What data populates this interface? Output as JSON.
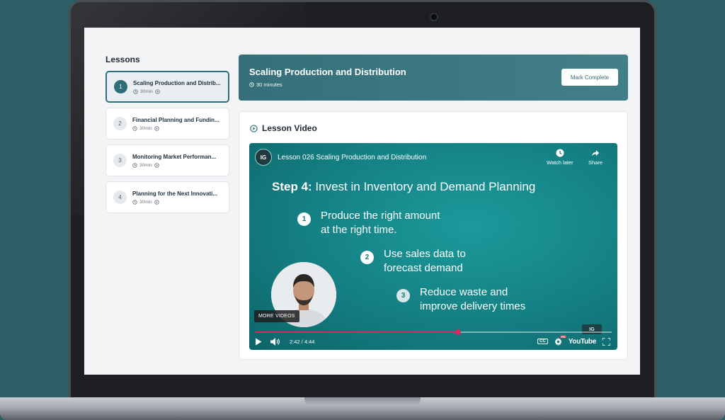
{
  "sidebar": {
    "title": "Lessons",
    "items": [
      {
        "number": "1",
        "title": "Scaling Production and Distrib...",
        "duration": "30min",
        "active": true
      },
      {
        "number": "2",
        "title": "Financial Planning and Fundin...",
        "duration": "30min",
        "active": false
      },
      {
        "number": "3",
        "title": "Monitoring Market Performan...",
        "duration": "30min",
        "active": false
      },
      {
        "number": "4",
        "title": "Planning for the Next Innovati...",
        "duration": "30min",
        "active": false
      }
    ]
  },
  "header": {
    "title": "Scaling Production and Distribution",
    "duration": "30 minutes",
    "mark_complete_label": "Mark Complete"
  },
  "video_section": {
    "title": "Lesson Video"
  },
  "player": {
    "channel_logo_text": "IG",
    "video_title": "Lesson 026 Scaling Production and Distribution",
    "watch_later_label": "Watch later",
    "share_label": "Share",
    "step_label": "Step 4:",
    "step_heading": "Invest in Inventory and Demand Planning",
    "points": [
      {
        "number": "1",
        "line1": "Produce the right amount",
        "line2": "at the right time."
      },
      {
        "number": "2",
        "line1": "Use sales data to",
        "line2": "forecast demand"
      },
      {
        "number": "3",
        "line1": "Reduce waste and",
        "line2": "improve delivery times"
      }
    ],
    "more_videos_label": "MORE VIDEOS",
    "time": "2:42 / 4:44",
    "progress_fraction": 0.57,
    "cc_label": "CC",
    "hd_badge": "HD",
    "youtube_label": "YouTube",
    "watermark_text": "IG"
  },
  "colors": {
    "accent": "#2f6e78",
    "video_bg": "#147f83",
    "progress": "#e0245e",
    "page_bg": "#2d5d66"
  }
}
